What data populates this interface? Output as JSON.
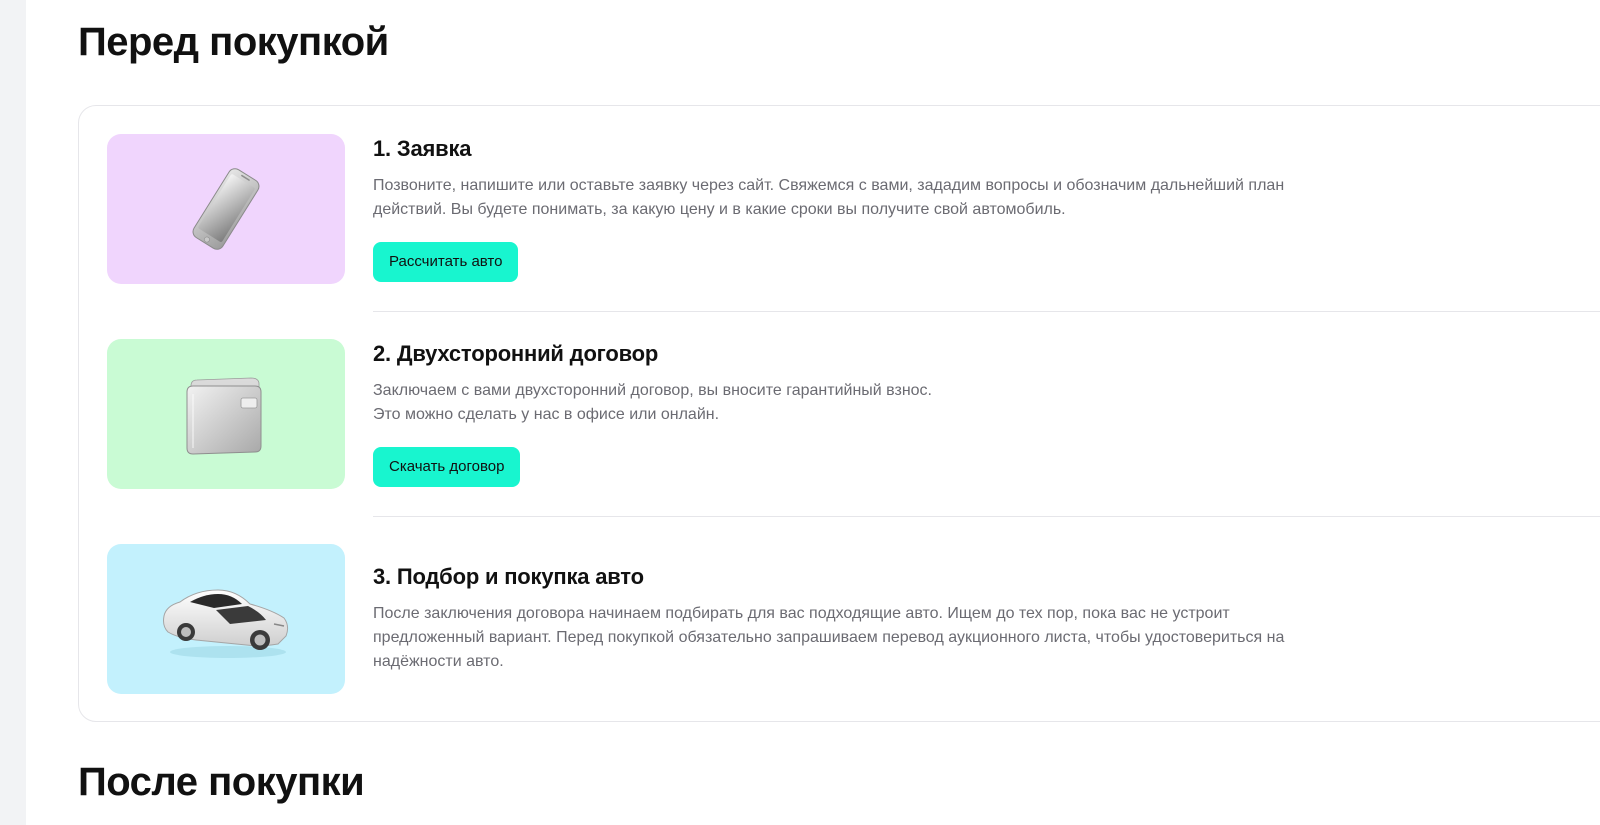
{
  "sections": {
    "before": {
      "title": "Перед покупкой"
    },
    "after": {
      "title": "После покупки"
    }
  },
  "colors": {
    "accent_button": "#18f5cf",
    "step1_bg": "#f0d5fd",
    "step2_bg": "#c9fbd4",
    "step3_bg": "#c3f1fd"
  },
  "steps": [
    {
      "title": "1. Заявка",
      "icon": "phone-icon",
      "desc_lines": [
        "Позвоните, напишите или оставьте заявку через сайт. Свяжемся с вами, зададим вопросы и обозначим дальнейший план",
        "действий. Вы будете понимать, за какую цену и в какие сроки вы получите свой автомобиль."
      ],
      "button_label": "Рассчитать авто"
    },
    {
      "title": "2. Двухсторонний договор",
      "icon": "folder-icon",
      "desc_lines": [
        "Заключаем с вами двухсторонний договор, вы вносите гарантийный взнос.",
        "Это можно сделать у нас в офисе или онлайн."
      ],
      "button_label": "Скачать договор"
    },
    {
      "title": "3. Подбор и покупка авто",
      "icon": "car-icon",
      "desc_lines": [
        "После заключения договора начинаем подбирать для вас подходящие авто. Ищем до тех пор, пока вас не устроит",
        "предложенный вариант. Перед покупкой обязательно запрашиваем перевод аукционного листа, чтобы удостовериться на",
        "надёжности авто."
      ]
    }
  ]
}
